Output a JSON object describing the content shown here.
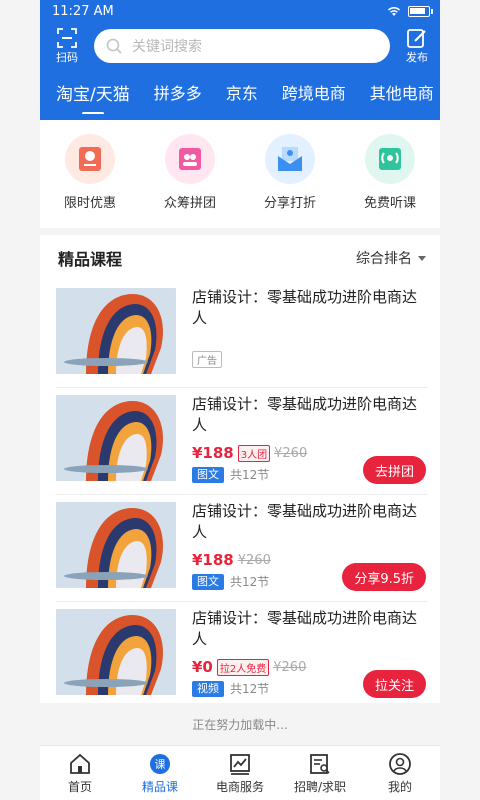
{
  "status": {
    "time": "11:27 AM"
  },
  "header": {
    "scan_label": "扫码",
    "publish_label": "发布",
    "search_placeholder": "关键词搜索",
    "tabs": [
      "淘宝/天猫",
      "拼多多",
      "京东",
      "跨境电商",
      "其他电商"
    ]
  },
  "quick_links": [
    {
      "label": "限时优惠",
      "icon": "coupon-icon",
      "bg": "#ffe9e3",
      "color": "#f26c55"
    },
    {
      "label": "众筹拼团",
      "icon": "group-ticket-icon",
      "bg": "#ffe6f0",
      "color": "#f15aa0"
    },
    {
      "label": "分享打折",
      "icon": "share-envelope-icon",
      "bg": "#e3f0ff",
      "color": "#3b8ff2"
    },
    {
      "label": "免费听课",
      "icon": "broadcast-icon",
      "bg": "#dff7f0",
      "color": "#2fc49b"
    }
  ],
  "section": {
    "title": "精品课程",
    "sort_label": "综合排名"
  },
  "courses": [
    {
      "title": "店铺设计：零基础成功进阶电商达人",
      "ad": "广告"
    },
    {
      "title": "店铺设计：零基础成功进阶电商达人",
      "price": "¥188",
      "badge": "3人团",
      "orig": "¥260",
      "type": "图文",
      "lessons": "共12节",
      "cta": "去拼团"
    },
    {
      "title": "店铺设计：零基础成功进阶电商达人",
      "price": "¥188",
      "orig": "¥260",
      "type": "图文",
      "lessons": "共12节",
      "cta": "分享9.5折"
    },
    {
      "title": "店铺设计：零基础成功进阶电商达人",
      "price": "¥0",
      "badge": "拉2人免费",
      "orig": "¥260",
      "type": "视频",
      "lessons": "共12节",
      "cta": "拉关注"
    }
  ],
  "loading_text": "正在努力加载中...",
  "bottom_nav": [
    {
      "label": "首页",
      "icon": "home-icon"
    },
    {
      "label": "精品课",
      "icon": "course-icon",
      "active": true
    },
    {
      "label": "电商服务",
      "icon": "chart-icon"
    },
    {
      "label": "招聘/求职",
      "icon": "resume-icon"
    },
    {
      "label": "我的",
      "icon": "user-icon"
    }
  ],
  "colors": {
    "brand": "#1f6fe0",
    "accent_red": "#e8233d",
    "tag_blue": "#2a7be4"
  }
}
